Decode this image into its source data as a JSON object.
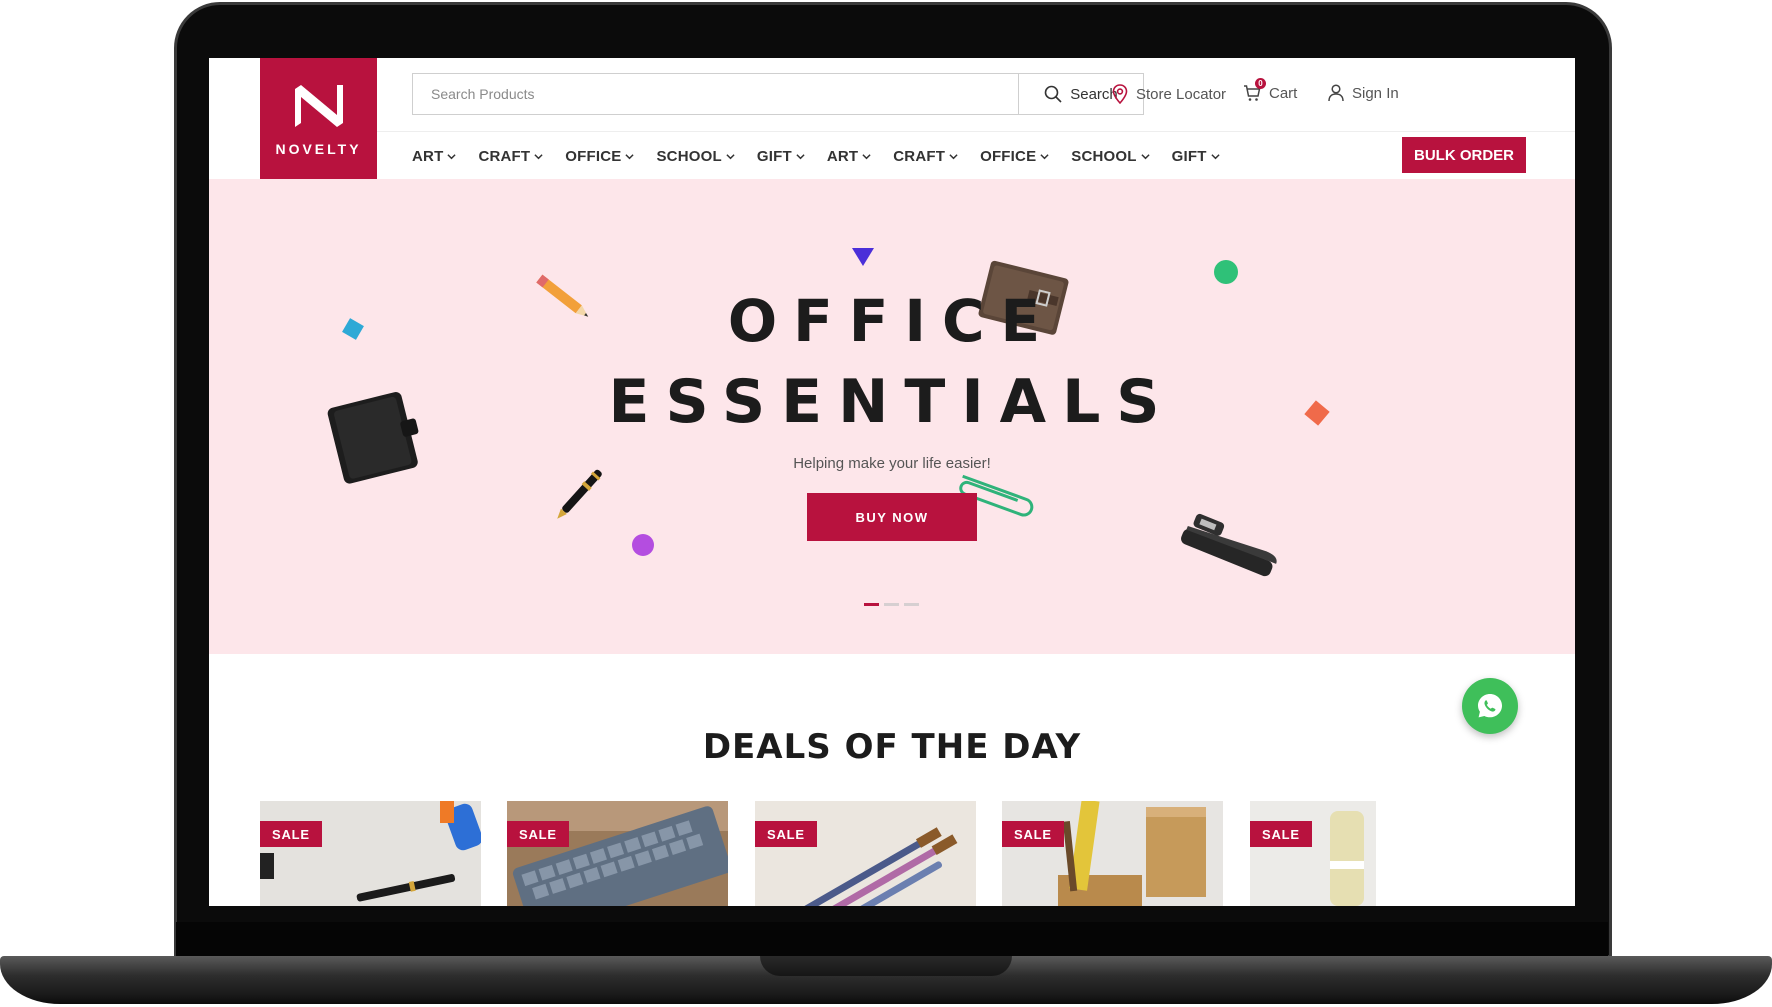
{
  "brand": {
    "name": "NOVELTY",
    "color": "#b8123e"
  },
  "search": {
    "placeholder": "Search Products",
    "button_label": "Search"
  },
  "top_links": {
    "store_locator": "Store Locator",
    "cart": "Cart",
    "cart_count": "0",
    "sign_in": "Sign In"
  },
  "nav": {
    "items": [
      "ART",
      "CRAFT",
      "OFFICE",
      "SCHOOL",
      "GIFT",
      "ART",
      "CRAFT",
      "OFFICE",
      "SCHOOL",
      "GIFT"
    ],
    "bulk_order": "BULK ORDER"
  },
  "hero": {
    "title_line1": "OFFICE",
    "title_line2": "ESSENTIALS",
    "subtitle": "Helping make your life easier!",
    "cta": "BUY NOW",
    "slides": 3,
    "active_slide": 1,
    "background": "#fde6ea"
  },
  "deals": {
    "title": "DEALS OF THE DAY",
    "badge": "SALE",
    "cards": [
      {
        "badge": "SALE",
        "image": "pen-on-paper"
      },
      {
        "badge": "SALE",
        "image": "keyboard"
      },
      {
        "badge": "SALE",
        "image": "paint-brushes"
      },
      {
        "badge": "SALE",
        "image": "ruler-in-holder"
      },
      {
        "badge": "SALE",
        "image": "bottle"
      }
    ]
  },
  "icons": [
    "search-icon",
    "map-pin-icon",
    "cart-icon",
    "user-icon",
    "chevron-down-icon",
    "whatsapp-icon"
  ]
}
